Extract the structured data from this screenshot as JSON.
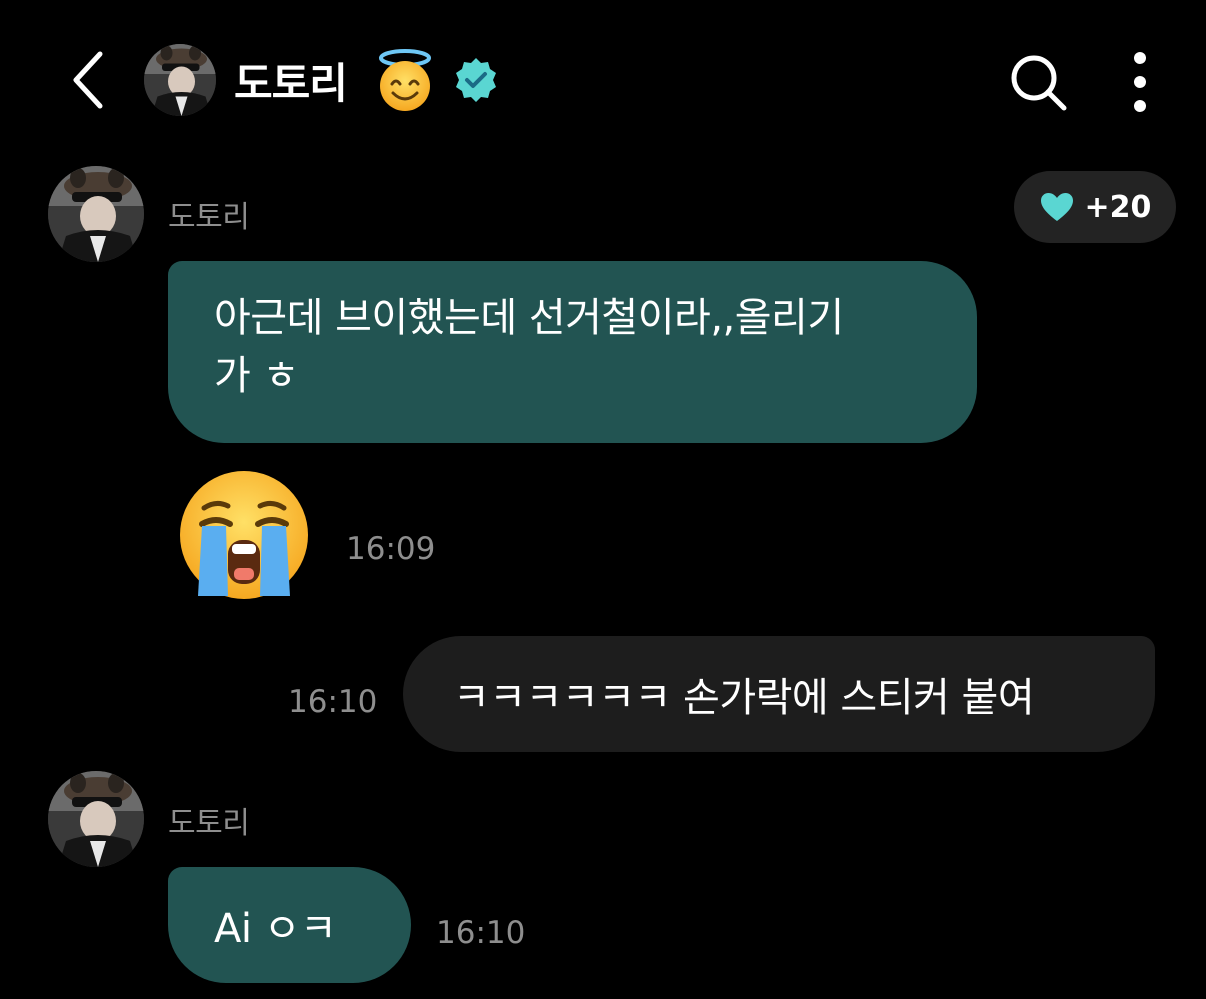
{
  "header": {
    "back_icon": "chevron-left-icon",
    "title": "도토리",
    "title_emoji": "smiling-face-with-halo",
    "verified_icon": "verified-badge-icon",
    "search_icon": "search-icon",
    "more_icon": "more-vertical-icon"
  },
  "colors": {
    "background": "#000000",
    "incoming_bubble": "#225452",
    "outgoing_bubble": "#1d1d1d",
    "secondary_text": "#8e8e8e",
    "accent_heart": "#5ad6d2"
  },
  "messages": [
    {
      "sender": "도토리",
      "reaction": {
        "icon": "heart-icon",
        "count": "+20"
      },
      "text_line1": "아근데 브이했는데 선거철이라,,올리기",
      "text_line2": "가 ㅎ",
      "sticker": "loudly-crying-face",
      "time": "16:09"
    },
    {
      "outgoing": true,
      "text": "ㅋㅋㅋㅋㅋㅋ 손가락에 스티커 붙여",
      "time": "16:10"
    },
    {
      "sender": "도토리",
      "text": "Ai ㅇㅋ",
      "time": "16:10"
    }
  ]
}
